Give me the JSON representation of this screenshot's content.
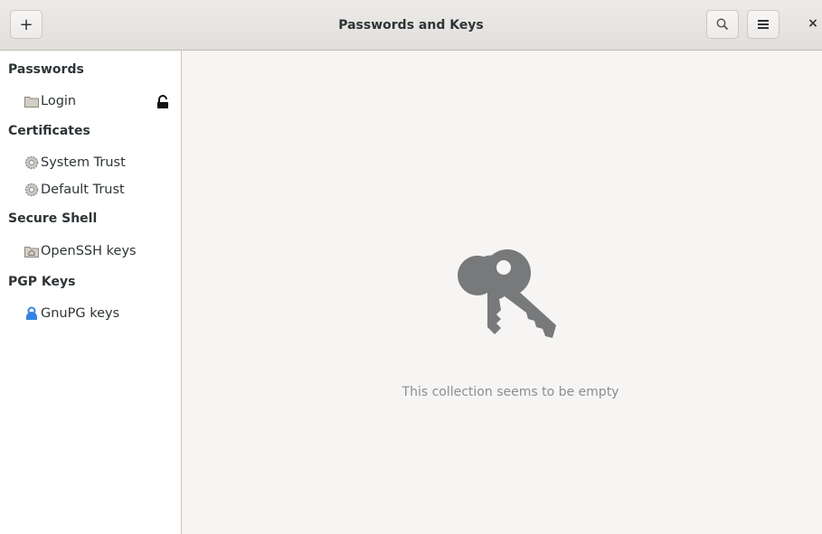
{
  "window": {
    "title": "Passwords and Keys",
    "add_label": "+",
    "close_label": "×"
  },
  "icons": {
    "add": "plus",
    "search": "search-icon",
    "menu": "hamburger-menu-icon",
    "close": "close-icon"
  },
  "sidebar": {
    "sections": [
      {
        "label": "Passwords",
        "items": [
          {
            "label": "Login",
            "icon": "folder-icon",
            "locked": true
          }
        ]
      },
      {
        "label": "Certificates",
        "items": [
          {
            "label": "System Trust",
            "icon": "gear-icon"
          },
          {
            "label": "Default Trust",
            "icon": "gear-icon"
          }
        ]
      },
      {
        "label": "Secure Shell",
        "items": [
          {
            "label": "OpenSSH keys",
            "icon": "home-folder-icon"
          }
        ]
      },
      {
        "label": "PGP Keys",
        "items": [
          {
            "label": "GnuPG keys",
            "icon": "person-icon"
          }
        ]
      }
    ]
  },
  "main": {
    "empty_message": "This collection seems to be empty"
  },
  "colors": {
    "accent": "#3584e4",
    "muted_text": "#8b8e8f",
    "icon_gray": "#77797a"
  }
}
